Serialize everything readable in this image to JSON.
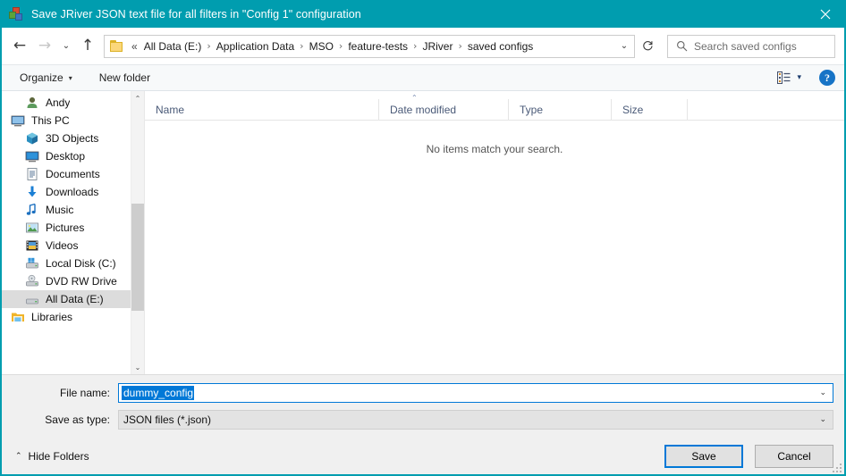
{
  "window": {
    "title": "Save JRiver JSON text file for all filters in \"Config 1\" configuration",
    "icon": "jriver-blocks-icon",
    "close_label": "✕",
    "titlebar_color": "#009daf",
    "accent_color": "#0078d7"
  },
  "nav": {
    "back": "←",
    "forward": "→",
    "recent": "⌄",
    "up": "↑",
    "refresh": "↻",
    "address_overflow": "«",
    "breadcrumbs": [
      "All Data (E:)",
      "Application Data",
      "MSO",
      "feature-tests",
      "JRiver",
      "saved configs"
    ],
    "separator": "›",
    "dropdown_caret": "⌄"
  },
  "search": {
    "placeholder": "Search saved configs",
    "icon": "search-icon"
  },
  "toolbar": {
    "organize_label": "Organize",
    "organize_caret": "▾",
    "new_folder_label": "New folder",
    "view_icon": "details-view-icon",
    "view_caret": "▾",
    "help_label": "?"
  },
  "sidebar": {
    "items": [
      {
        "label": "Andy",
        "icon": "user-icon",
        "indent": 1,
        "selected": false
      },
      {
        "label": "This PC",
        "icon": "monitor-icon",
        "indent": 0,
        "selected": false
      },
      {
        "label": "3D Objects",
        "icon": "cube-icon",
        "indent": 1,
        "selected": false
      },
      {
        "label": "Desktop",
        "icon": "desktop-icon",
        "indent": 1,
        "selected": false
      },
      {
        "label": "Documents",
        "icon": "documents-icon",
        "indent": 1,
        "selected": false
      },
      {
        "label": "Downloads",
        "icon": "downloads-icon",
        "indent": 1,
        "selected": false
      },
      {
        "label": "Music",
        "icon": "music-icon",
        "indent": 1,
        "selected": false
      },
      {
        "label": "Pictures",
        "icon": "pictures-icon",
        "indent": 1,
        "selected": false
      },
      {
        "label": "Videos",
        "icon": "videos-icon",
        "indent": 1,
        "selected": false
      },
      {
        "label": "Local Disk (C:)",
        "icon": "local-disk-icon",
        "indent": 1,
        "selected": false
      },
      {
        "label": "DVD RW Drive",
        "icon": "dvd-drive-icon",
        "indent": 1,
        "selected": false
      },
      {
        "label": "All Data (E:)",
        "icon": "drive-icon",
        "indent": 1,
        "selected": true
      },
      {
        "label": "Libraries",
        "icon": "libraries-folder-icon",
        "indent": 0,
        "selected": false
      }
    ],
    "scroll_up": "⌃",
    "scroll_down": "⌄"
  },
  "filelist": {
    "columns": [
      "Name",
      "Date modified",
      "Type",
      "Size"
    ],
    "sort_indicator": "⌃",
    "rows": [],
    "empty_message": "No items match your search."
  },
  "footer": {
    "filename_label": "File name:",
    "filename_value": "dummy_config",
    "filetype_label": "Save as type:",
    "filetype_value": "JSON files (*.json)",
    "combo_caret": "⌄",
    "hide_folders_label": "Hide Folders",
    "hide_folders_caret": "⌃",
    "save_label": "Save",
    "cancel_label": "Cancel"
  }
}
